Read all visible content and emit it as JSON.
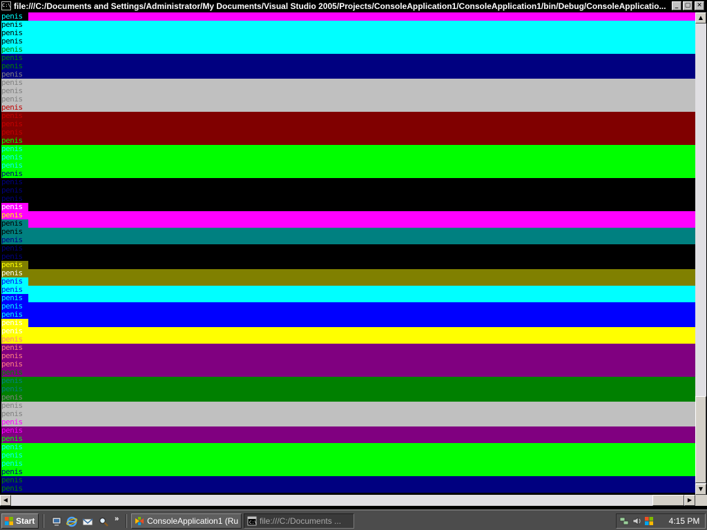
{
  "window": {
    "title": "file:///C:/Documents and Settings/Administrator/My Documents/Visual Studio 2005/Projects/ConsoleApplication1/ConsoleApplication1/bin/Debug/ConsoleApplicatio...",
    "icon_text": "C:\\",
    "minimize_glyph": "_",
    "maximize_glyph": "▢",
    "close_glyph": "✕"
  },
  "console": {
    "word": "penis",
    "lines": [
      {
        "fg": "#00ffff",
        "bg": "#000000",
        "bar": "#ff00ff"
      },
      {
        "fg": "#000000",
        "bg": "#00ffff",
        "bar": "#00ffff"
      },
      {
        "fg": "#000000",
        "bg": "#00ffff",
        "bar": "#00ffff"
      },
      {
        "fg": "#000000",
        "bg": "#00ffff",
        "bar": "#00ffff"
      },
      {
        "fg": "#008000",
        "bg": "#00ffff",
        "bar": "#00ffff"
      },
      {
        "fg": "#008000",
        "bg": "#000080",
        "bar": "#000080"
      },
      {
        "fg": "#008000",
        "bg": "#000080",
        "bar": "#000080"
      },
      {
        "fg": "#808080",
        "bg": "#000080",
        "bar": "#000080"
      },
      {
        "fg": "#808080",
        "bg": "#c0c0c0",
        "bar": "#c0c0c0"
      },
      {
        "fg": "#808080",
        "bg": "#c0c0c0",
        "bar": "#c0c0c0"
      },
      {
        "fg": "#808080",
        "bg": "#c0c0c0",
        "bar": "#c0c0c0"
      },
      {
        "fg": "#c00000",
        "bg": "#c0c0c0",
        "bar": "#c0c0c0"
      },
      {
        "fg": "#c00000",
        "bg": "#800000",
        "bar": "#800000"
      },
      {
        "fg": "#c00000",
        "bg": "#800000",
        "bar": "#800000"
      },
      {
        "fg": "#c00000",
        "bg": "#800000",
        "bar": "#800000"
      },
      {
        "fg": "#00ff00",
        "bg": "#800000",
        "bar": "#800000"
      },
      {
        "fg": "#00ffff",
        "bg": "#00ff00",
        "bar": "#00ff00"
      },
      {
        "fg": "#00ffff",
        "bg": "#00ff00",
        "bar": "#00ff00"
      },
      {
        "fg": "#00ffff",
        "bg": "#00ff00",
        "bar": "#00ff00"
      },
      {
        "fg": "#000080",
        "bg": "#00ff00",
        "bar": "#00ff00"
      },
      {
        "fg": "#000080",
        "bg": "#000000",
        "bar": "#000000"
      },
      {
        "fg": "#000080",
        "bg": "#000000",
        "bar": "#000000"
      },
      {
        "fg": "#000080",
        "bg": "#000000",
        "bar": "#000000"
      },
      {
        "fg": "#ffffff",
        "bg": "#ff00ff",
        "bar": "#000000"
      },
      {
        "fg": "#ffff00",
        "bg": "#ff00ff",
        "bar": "#ff00ff"
      },
      {
        "fg": "#000000",
        "bg": "#008080",
        "bar": "#ff00ff"
      },
      {
        "fg": "#000000",
        "bg": "#008080",
        "bar": "#008080"
      },
      {
        "fg": "#000080",
        "bg": "#008080",
        "bar": "#008080"
      },
      {
        "fg": "#000080",
        "bg": "#000000",
        "bar": "#000000"
      },
      {
        "fg": "#000080",
        "bg": "#000000",
        "bar": "#000000"
      },
      {
        "fg": "#ffff00",
        "bg": "#808000",
        "bar": "#000000"
      },
      {
        "fg": "#ffffff",
        "bg": "#808000",
        "bar": "#808000"
      },
      {
        "fg": "#0000ff",
        "bg": "#00ffff",
        "bar": "#808000"
      },
      {
        "fg": "#0000ff",
        "bg": "#00ffff",
        "bar": "#00ffff"
      },
      {
        "fg": "#00ffff",
        "bg": "#0000ff",
        "bar": "#00ffff"
      },
      {
        "fg": "#00ffff",
        "bg": "#0000ff",
        "bar": "#0000ff"
      },
      {
        "fg": "#00ffff",
        "bg": "#0000ff",
        "bar": "#0000ff"
      },
      {
        "fg": "#ffffff",
        "bg": "#ffff00",
        "bar": "#0000ff"
      },
      {
        "fg": "#ffffff",
        "bg": "#ffff00",
        "bar": "#ffff00"
      },
      {
        "fg": "#ff8080",
        "bg": "#ffff00",
        "bar": "#ffff00"
      },
      {
        "fg": "#ff8080",
        "bg": "#800080",
        "bar": "#800080"
      },
      {
        "fg": "#ff8080",
        "bg": "#800080",
        "bar": "#800080"
      },
      {
        "fg": "#ff8080",
        "bg": "#800080",
        "bar": "#800080"
      },
      {
        "fg": "#008000",
        "bg": "#800080",
        "bar": "#800080"
      },
      {
        "fg": "#008080",
        "bg": "#008000",
        "bar": "#008000"
      },
      {
        "fg": "#008080",
        "bg": "#008000",
        "bar": "#008000"
      },
      {
        "fg": "#808080",
        "bg": "#008000",
        "bar": "#008000"
      },
      {
        "fg": "#808080",
        "bg": "#c0c0c0",
        "bar": "#c0c0c0"
      },
      {
        "fg": "#808080",
        "bg": "#c0c0c0",
        "bar": "#c0c0c0"
      },
      {
        "fg": "#ff00ff",
        "bg": "#c0c0c0",
        "bar": "#c0c0c0"
      },
      {
        "fg": "#ff00ff",
        "bg": "#800080",
        "bar": "#800080"
      },
      {
        "fg": "#00ff00",
        "bg": "#800080",
        "bar": "#800080"
      },
      {
        "fg": "#00ffff",
        "bg": "#00ff00",
        "bar": "#00ff00"
      },
      {
        "fg": "#00ffff",
        "bg": "#00ff00",
        "bar": "#00ff00"
      },
      {
        "fg": "#00ffff",
        "bg": "#00ff00",
        "bar": "#00ff00"
      },
      {
        "fg": "#000080",
        "bg": "#00ff00",
        "bar": "#00ff00"
      },
      {
        "fg": "#008000",
        "bg": "#000080",
        "bar": "#000080"
      },
      {
        "fg": "#008000",
        "bg": "#000080",
        "bar": "#000080"
      }
    ]
  },
  "scrollbars": {
    "up_arrow": "▲",
    "down_arrow": "▼",
    "left_arrow": "◀",
    "right_arrow": "▶"
  },
  "taskbar": {
    "start_label": "Start",
    "quicklaunch_icons": [
      "desktop-icon",
      "internet-explorer-icon",
      "outlook-express-icon",
      "search-icon"
    ],
    "quicklaunch_chevron": "»",
    "tasks": [
      {
        "label": "ConsoleApplication1 (Run...",
        "icon": "visual-studio-icon",
        "active": false
      },
      {
        "label": "file:///C:/Documents ...",
        "icon": "console-icon",
        "active": true
      }
    ],
    "tray_icons": [
      "network-icon",
      "speaker-icon",
      "windows-security-icon"
    ],
    "clock": "4:15 PM"
  }
}
